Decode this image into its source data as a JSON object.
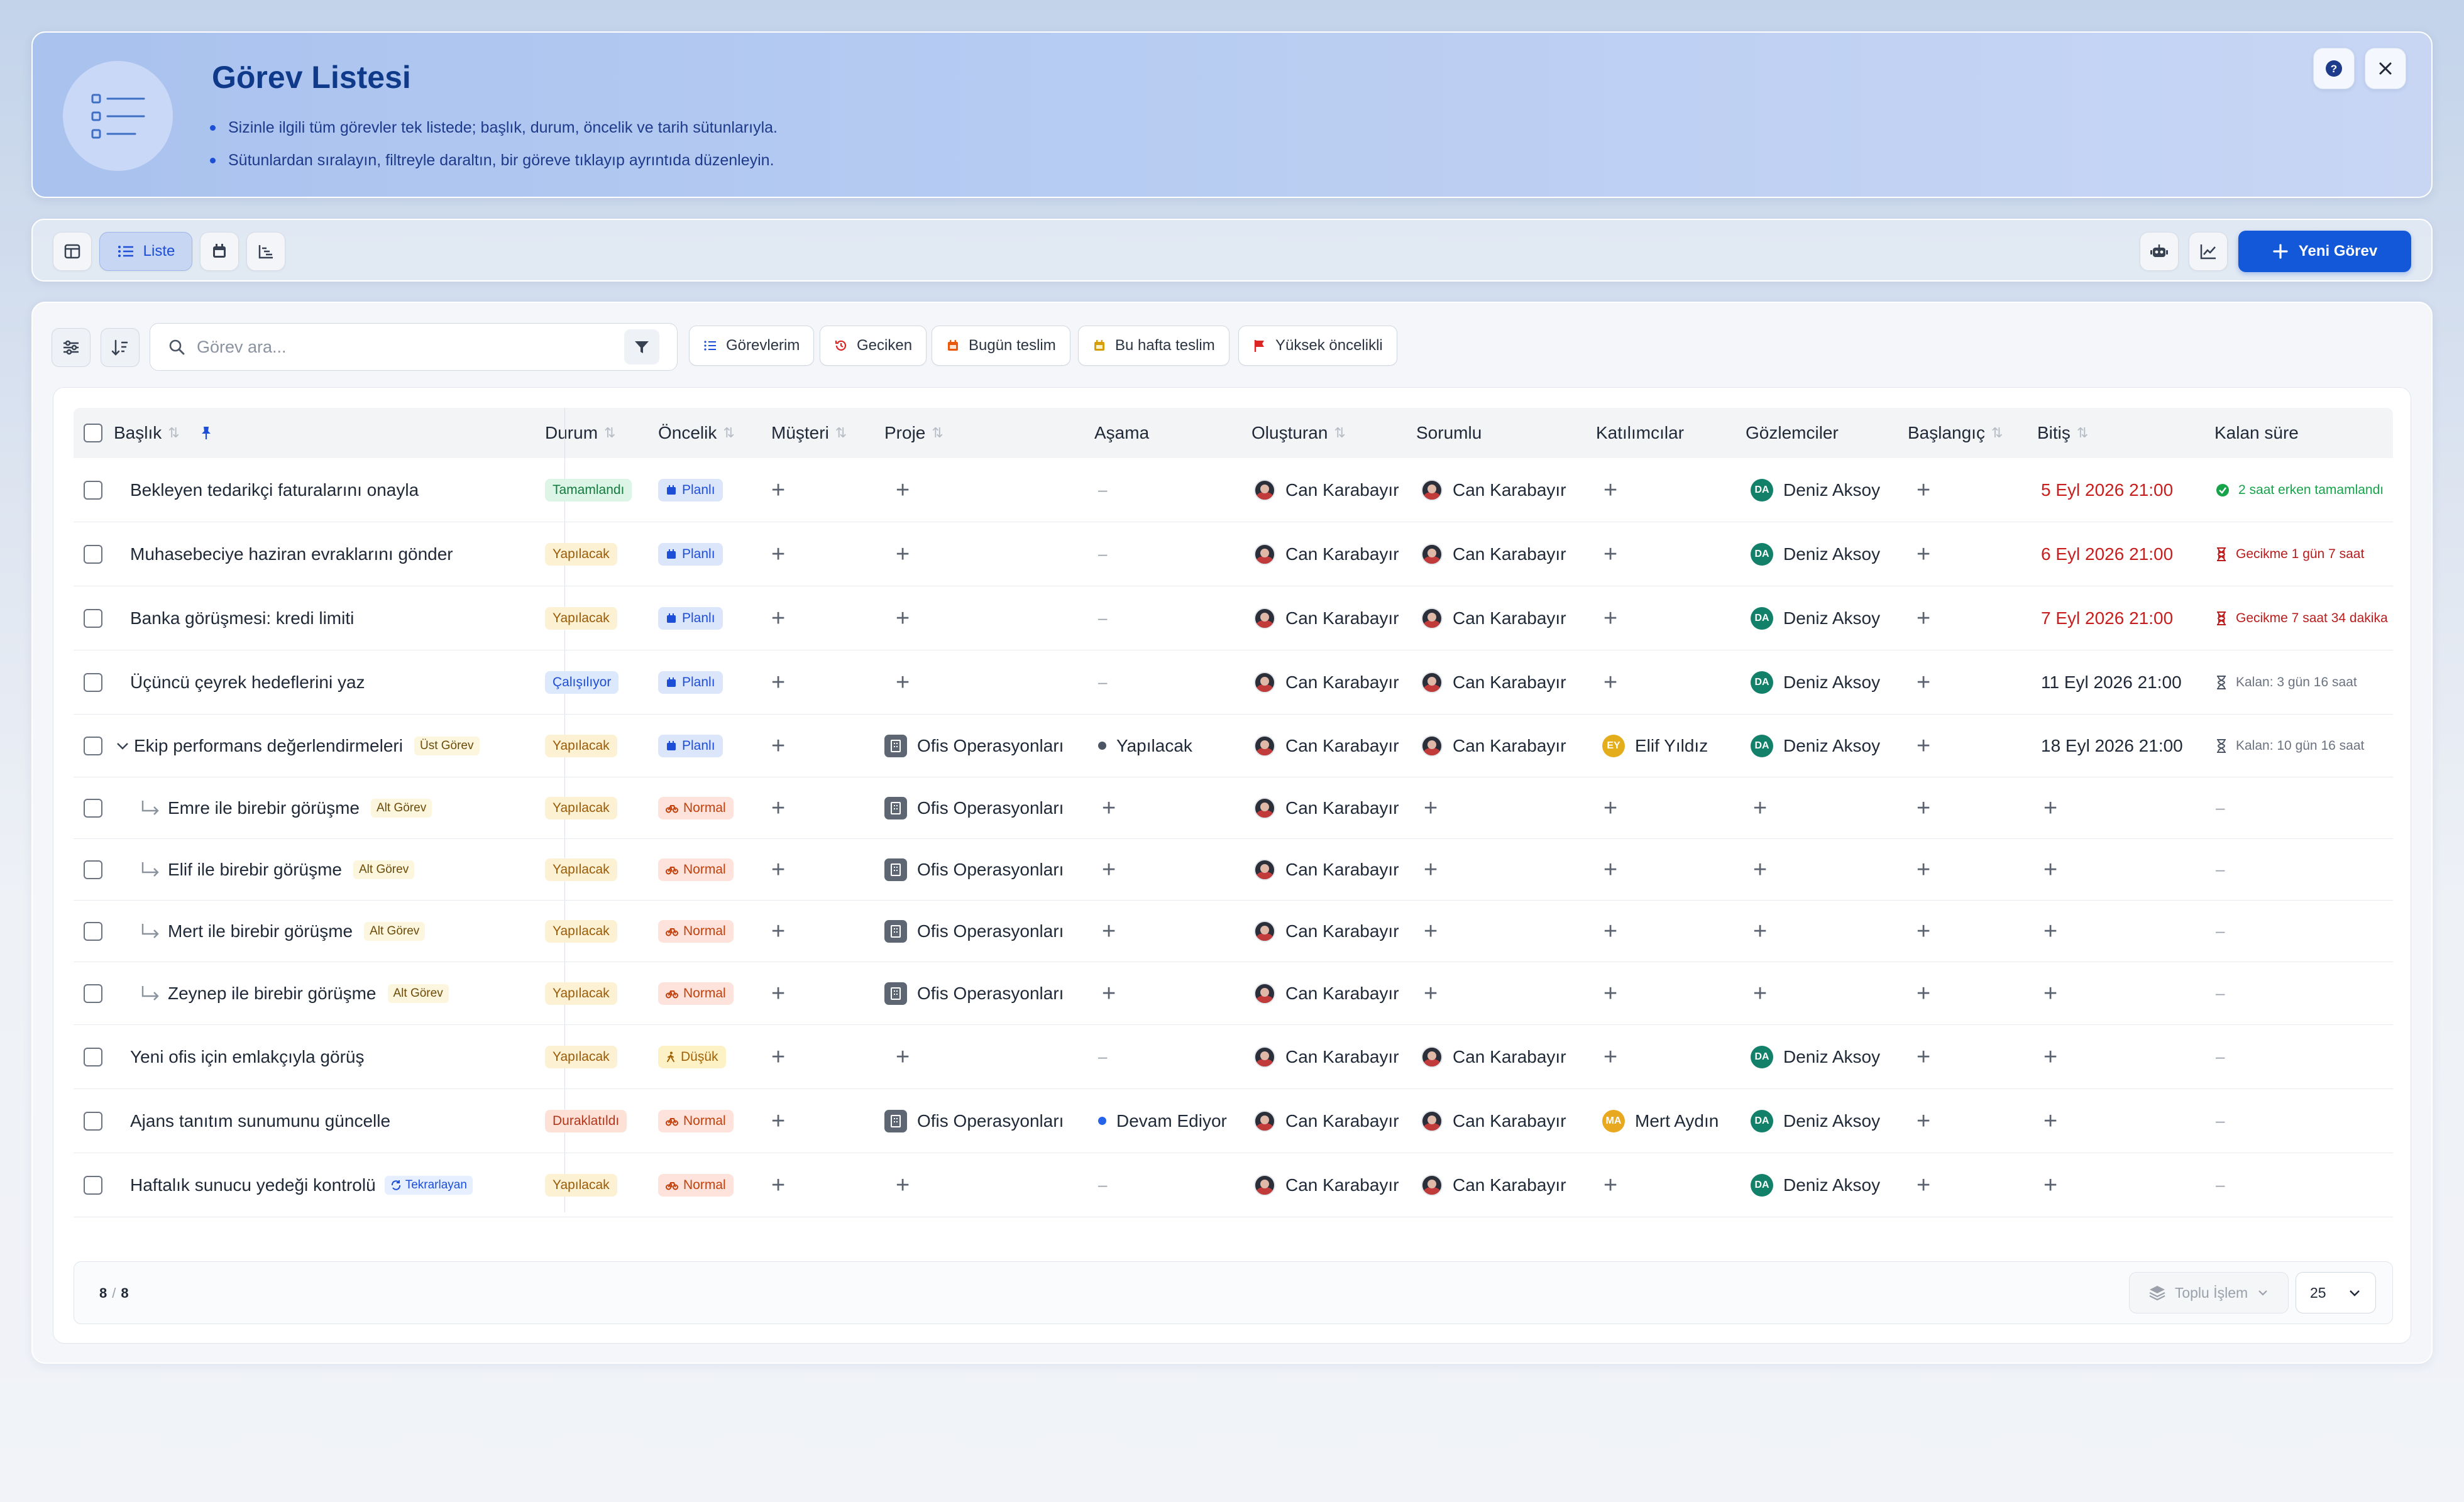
{
  "banner": {
    "title": "Görev Listesi",
    "bullets": [
      "Sizinle ilgili tüm görevler tek listede; başlık, durum, öncelik ve tarih sütunlarıyla.",
      "Sütunlardan sıralayın, filtreyle daraltın, bir göreve tıklayıp ayrıntıda düzenleyin."
    ]
  },
  "toolbar": {
    "list_label": "Liste",
    "new_task_label": "Yeni Görev"
  },
  "filters": {
    "search_placeholder": "Görev ara...",
    "chips": [
      "Görevlerim",
      "Geciken",
      "Bugün teslim",
      "Bu hafta teslim",
      "Yüksek öncelikli"
    ]
  },
  "columns": [
    "Başlık",
    "Durum",
    "Öncelik",
    "Müşteri",
    "Proje",
    "Aşama",
    "Oluşturan",
    "Sorumlu",
    "Katılımcılar",
    "Gözlemciler",
    "Başlangıç",
    "Bitiş",
    "Kalan süre"
  ],
  "rows": [
    {
      "title": "Bekleyen tedarikçi faturalarını onayla",
      "status": "Tamamlandı",
      "priority": "Planlı",
      "project": "",
      "stage": "–",
      "creator": "Can Karabayır",
      "owner": "Can Karabayır",
      "participant": "",
      "observer": "Deniz Aksoy",
      "observer_initials": "DA",
      "due": "5 Eyl 2026 21:00",
      "remaining": "2 saat erken tamamlandı"
    },
    {
      "title": "Muhasebeciye haziran evraklarını gönder",
      "status": "Yapılacak",
      "priority": "Planlı",
      "project": "",
      "stage": "–",
      "creator": "Can Karabayır",
      "owner": "Can Karabayır",
      "participant": "",
      "observer": "Deniz Aksoy",
      "observer_initials": "DA",
      "due": "6 Eyl 2026 21:00",
      "remaining": "Gecikme 1 gün 7 saat"
    },
    {
      "title": "Banka görüşmesi: kredi limiti",
      "status": "Yapılacak",
      "priority": "Planlı",
      "project": "",
      "stage": "–",
      "creator": "Can Karabayır",
      "owner": "Can Karabayır",
      "participant": "",
      "observer": "Deniz Aksoy",
      "observer_initials": "DA",
      "due": "7 Eyl 2026 21:00",
      "remaining": "Gecikme 7 saat 34 dakika"
    },
    {
      "title": "Üçüncü çeyrek hedeflerini yaz",
      "status": "Çalışılıyor",
      "priority": "Planlı",
      "project": "",
      "stage": "–",
      "creator": "Can Karabayır",
      "owner": "Can Karabayır",
      "participant": "",
      "observer": "Deniz Aksoy",
      "observer_initials": "DA",
      "due": "11 Eyl 2026 21:00",
      "remaining": "Kalan: 3 gün 16 saat"
    },
    {
      "title": "Ekip performans değerlendirmeleri",
      "tag": "Üst Görev",
      "status": "Yapılacak",
      "priority": "Planlı",
      "project": "Ofis Operasyonları",
      "stage": "Yapılacak",
      "creator": "Can Karabayır",
      "owner": "Can Karabayır",
      "participant": "Elif Yıldız",
      "participant_initials": "EY",
      "observer": "Deniz Aksoy",
      "observer_initials": "DA",
      "due": "18 Eyl 2026 21:00",
      "remaining": "Kalan: 10 gün 16 saat"
    },
    {
      "title": "Emre ile birebir görüşme",
      "tag": "Alt Görev",
      "status": "Yapılacak",
      "priority": "Normal",
      "project": "Ofis Operasyonları",
      "creator": "Can Karabayır",
      "remaining": "–"
    },
    {
      "title": "Elif ile birebir görüşme",
      "tag": "Alt Görev",
      "status": "Yapılacak",
      "priority": "Normal",
      "project": "Ofis Operasyonları",
      "creator": "Can Karabayır",
      "remaining": "–"
    },
    {
      "title": "Mert ile birebir görüşme",
      "tag": "Alt Görev",
      "status": "Yapılacak",
      "priority": "Normal",
      "project": "Ofis Operasyonları",
      "creator": "Can Karabayır",
      "remaining": "–"
    },
    {
      "title": "Zeynep ile birebir görüşme",
      "tag": "Alt Görev",
      "status": "Yapılacak",
      "priority": "Normal",
      "project": "Ofis Operasyonları",
      "creator": "Can Karabayır",
      "remaining": "–"
    },
    {
      "title": "Yeni ofis için emlakçıyla görüş",
      "status": "Yapılacak",
      "priority": "Düşük",
      "project": "",
      "stage": "–",
      "creator": "Can Karabayır",
      "owner": "Can Karabayır",
      "observer": "Deniz Aksoy",
      "observer_initials": "DA",
      "remaining": "–"
    },
    {
      "title": "Ajans tanıtım sunumunu güncelle",
      "status": "Duraklatıldı",
      "priority": "Normal",
      "project": "Ofis Operasyonları",
      "stage": "Devam Ediyor",
      "creator": "Can Karabayır",
      "owner": "Can Karabayır",
      "participant": "Mert Aydın",
      "participant_initials": "MA",
      "observer": "Deniz Aksoy",
      "observer_initials": "DA",
      "remaining": "–"
    },
    {
      "title": "Haftalık sunucu yedeği kontrolü",
      "tag": "Tekrarlayan",
      "status": "Yapılacak",
      "priority": "Normal",
      "project": "",
      "stage": "–",
      "creator": "Can Karabayır",
      "owner": "Can Karabayır",
      "observer": "Deniz Aksoy",
      "observer_initials": "DA",
      "remaining": "–"
    }
  ],
  "footer": {
    "count_shown": "8",
    "count_sep": "/",
    "count_total": "8",
    "bulk_label": "Toplu İşlem",
    "page_size": "25"
  }
}
